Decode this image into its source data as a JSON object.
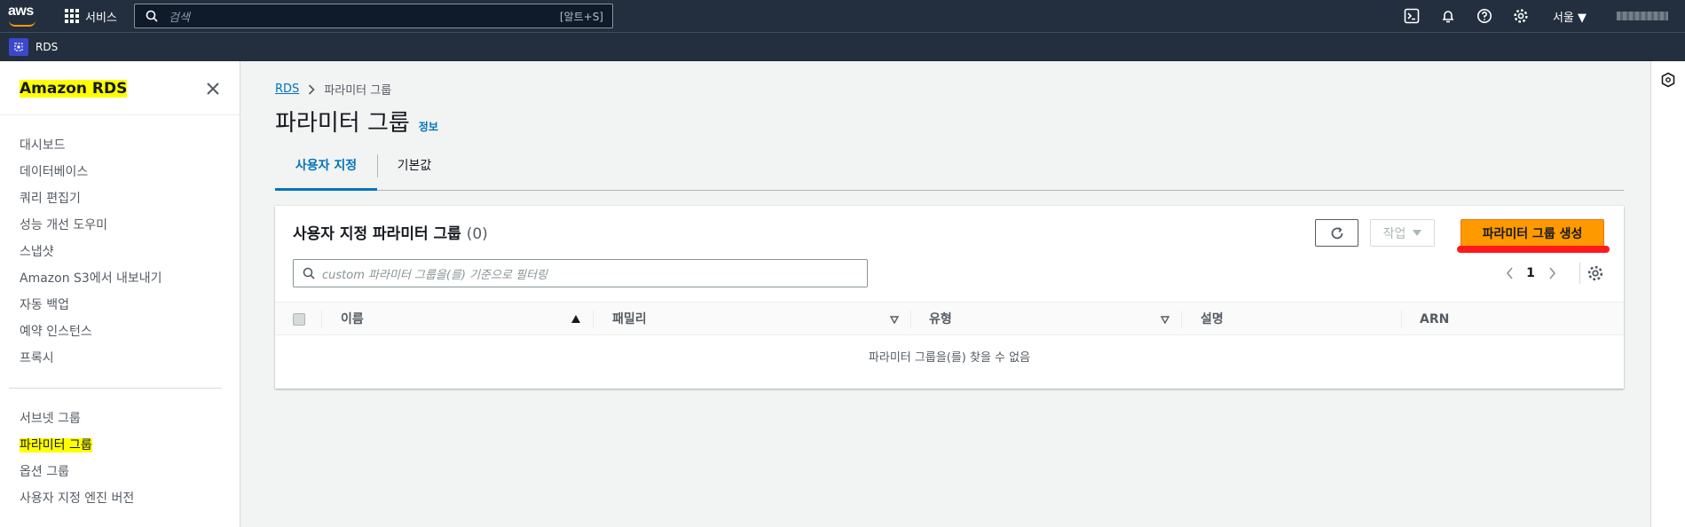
{
  "topbar": {
    "logo_text": "aws",
    "services_label": "서비스",
    "search_placeholder": "검색",
    "search_shortcut": "[알트+S]",
    "region_label": "서울 ▼"
  },
  "secondary": {
    "favorite_label": "RDS"
  },
  "sidebar": {
    "title": "Amazon RDS",
    "items_primary": [
      "대시보드",
      "데이터베이스",
      "쿼리 편집기",
      "성능 개선 도우미",
      "스냅샷",
      "Amazon S3에서 내보내기",
      "자동 백업",
      "예약 인스턴스",
      "프록시"
    ],
    "items_secondary": [
      "서브넷 그룹",
      "파라미터 그룹",
      "옵션 그룹",
      "사용자 지정 엔진 버전"
    ],
    "active_item": "파라미터 그룹"
  },
  "breadcrumb": {
    "root": "RDS",
    "current": "파라미터 그룹"
  },
  "page": {
    "title": "파라미터 그룹",
    "info_link": "정보"
  },
  "tabs": [
    "사용자 지정",
    "기본값"
  ],
  "panel": {
    "title": "사용자 지정 파라미터 그룹",
    "count": "(0)",
    "action_button": "작업",
    "create_button": "파라미터 그룹 생성",
    "filter_placeholder": "custom 파라미터 그룹을(를) 기준으로 필터링",
    "page_number": "1",
    "columns": [
      "이름",
      "패밀리",
      "유형",
      "설명",
      "ARN"
    ],
    "empty_message": "파라미터 그룹을(를) 찾을 수 없음"
  },
  "colors": {
    "nav_bg": "#232f3e",
    "accent_orange": "#ff9900",
    "link_blue": "#0073bb",
    "highlight_yellow": "#ffff00",
    "annotation_red": "#ff1a1a"
  }
}
